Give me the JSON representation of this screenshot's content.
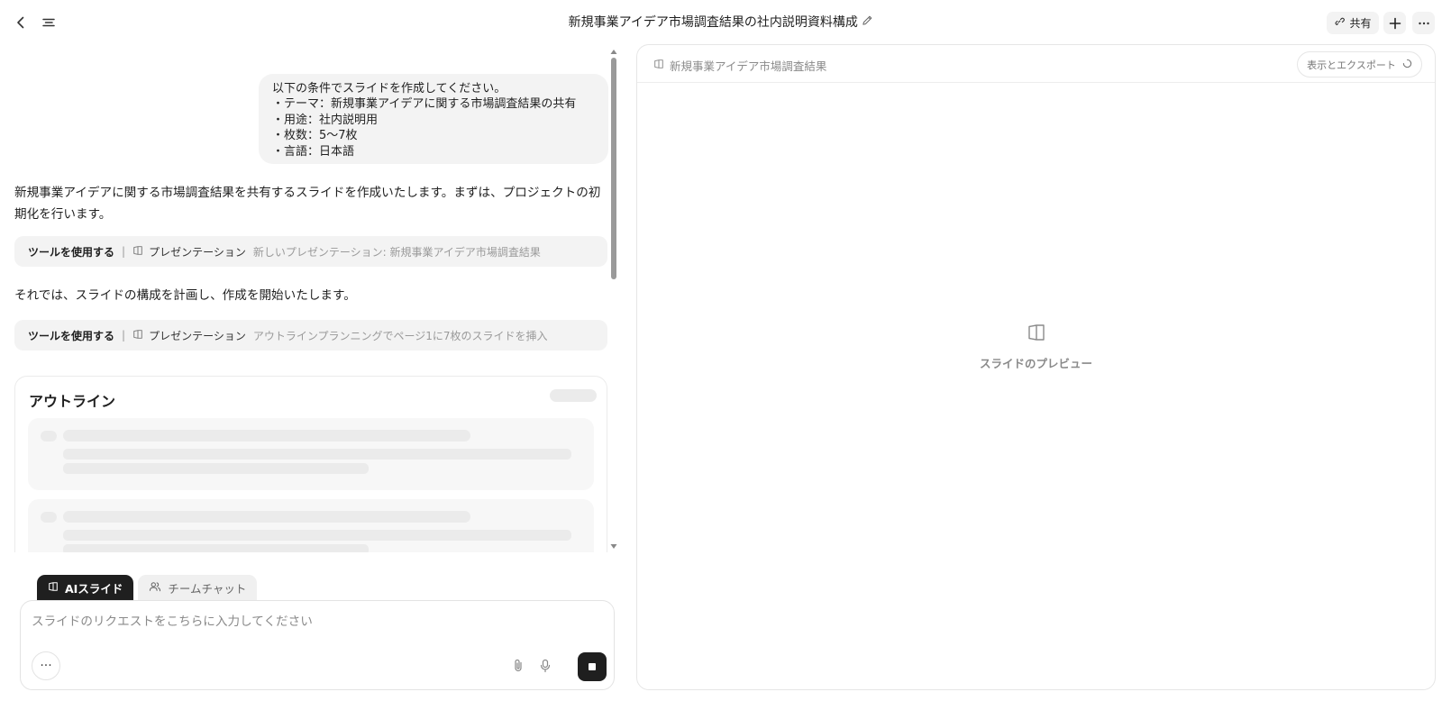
{
  "header": {
    "title": "新規事業アイデア市場調査結果の社内説明資料構成",
    "share_label": "共有"
  },
  "chat": {
    "user_message": "以下の条件でスライドを作成してください。\n・テーマ：新規事業アイデアに関する市場調査結果の共有\n・用途：社内説明用\n・枚数：5〜7枚\n・言語：日本語",
    "assistant_message_1": "新規事業アイデアに関する市場調査結果を共有するスライドを作成いたします。まずは、プロジェクトの初期化を行います。",
    "tool_call_1": {
      "label": "ツールを使用する",
      "tool": "プレゼンテーション",
      "detail": "新しいプレゼンテーション: 新規事業アイデア市場調査結果"
    },
    "assistant_message_2": "それでは、スライドの構成を計画し、作成を開始いたします。",
    "tool_call_2": {
      "label": "ツールを使用する",
      "tool": "プレゼンテーション",
      "detail": "アウトラインプランニングでページ1に7枚のスライドを挿入"
    },
    "outline_title": "アウトライン"
  },
  "composer": {
    "tabs": [
      {
        "label": "AIスライド",
        "active": true
      },
      {
        "label": "チームチャット",
        "active": false
      }
    ],
    "placeholder": "スライドのリクエストをこちらに入力してください",
    "more_label": "···"
  },
  "preview": {
    "file_name": "新規事業アイデア市場調査結果",
    "export_label": "表示とエクスポート",
    "empty_label": "スライドのプレビュー"
  }
}
